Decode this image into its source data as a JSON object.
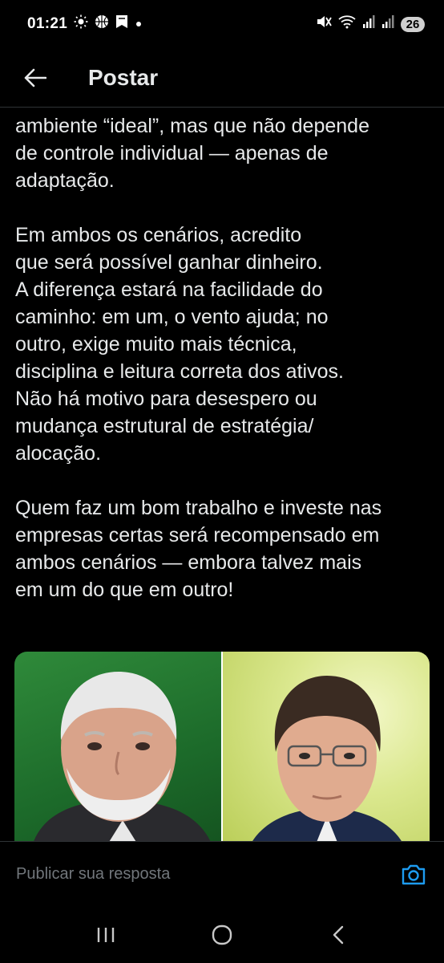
{
  "status_bar": {
    "time": "01:21",
    "battery": "26",
    "left_icons": [
      "sun-icon",
      "basketball-icon",
      "bookmark-icon",
      "dot-icon"
    ],
    "right_icons": [
      "mute-icon",
      "wifi-icon",
      "signal-icon",
      "signal-roaming-icon"
    ]
  },
  "header": {
    "title": "Postar",
    "back_icon": "arrow-left-icon"
  },
  "post": {
    "text": "ambiente “ideal”, mas que não depende\nde controle individual — apenas de\nadaptação.\n\nEm ambos os cenários, acredito\nque será possível ganhar dinheiro.\nA diferença estará na facilidade do\ncaminho: em um, o vento ajuda; no\noutro, exige muito mais técnica,\ndisciplina e leitura correta dos ativos.\nNão há motivo para desespero ou\nmudança estrutural de estratégia/\nalocação.\n\nQuem faz um bom trabalho e investe nas\nempresas certas será recompensado em\nambos cenários — embora talvez mais\nem um do que em outro!"
  },
  "reply": {
    "placeholder": "Publicar sua resposta",
    "camera_icon": "camera-icon"
  },
  "nav": {
    "icons": [
      "recent-apps-icon",
      "home-icon",
      "back-icon"
    ]
  },
  "colors": {
    "background": "#000000",
    "text": "#e7e9ea",
    "muted": "#71767b",
    "accent": "#1d9bf0",
    "divider": "#2f3336"
  }
}
